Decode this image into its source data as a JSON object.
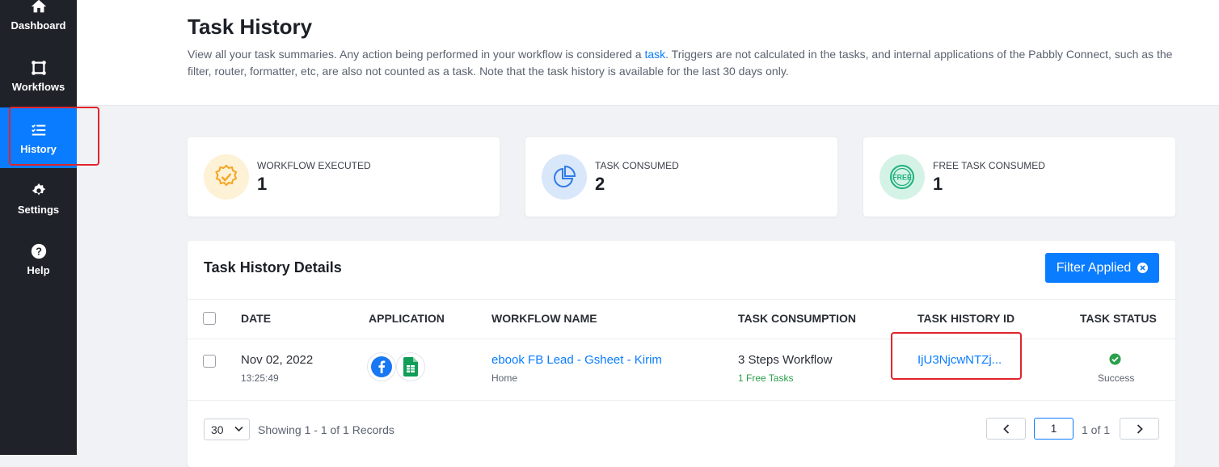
{
  "sidebar": {
    "items": [
      {
        "label": "Dashboard",
        "icon": "home-icon"
      },
      {
        "label": "Workflows",
        "icon": "workflow-icon"
      },
      {
        "label": "History",
        "icon": "history-list-icon",
        "active": true
      },
      {
        "label": "Settings",
        "icon": "gear-icon"
      },
      {
        "label": "Help",
        "icon": "help-icon"
      }
    ]
  },
  "header": {
    "title": "Task History",
    "desc_before": "View all your task summaries. Any action being performed in your workflow is considered a ",
    "desc_link": "task",
    "desc_after": ". Triggers are not calculated in the tasks, and internal applications of the Pabbly Connect, such as the filter, router, formatter, etc, are also not counted as a task. Note that the task history is available for the last 30 days only."
  },
  "stats": [
    {
      "label": "WORKFLOW EXECUTED",
      "value": "1",
      "icon": "badge-check-icon",
      "color": "#f5a623"
    },
    {
      "label": "TASK CONSUMED",
      "value": "2",
      "icon": "pie-chart-icon",
      "color": "#2f7be5"
    },
    {
      "label": "FREE TASK CONSUMED",
      "value": "1",
      "icon": "free-badge-icon",
      "color": "#1fb07a"
    }
  ],
  "details": {
    "title": "Task History Details",
    "filter_label": "Filter Applied",
    "columns": [
      "DATE",
      "APPLICATION",
      "WORKFLOW NAME",
      "TASK CONSUMPTION",
      "TASK HISTORY ID",
      "TASK STATUS"
    ],
    "rows": [
      {
        "date": "Nov 02, 2022",
        "time": "13:25:49",
        "apps": [
          "facebook-icon",
          "google-sheets-icon"
        ],
        "workflow_name": "ebook FB Lead - Gsheet - Kirim",
        "workflow_folder": "Home",
        "consumption": "3 Steps Workflow",
        "free_tasks": "1 Free Tasks",
        "history_id": "IjU3NjcwNTZj...",
        "status": "Success"
      }
    ]
  },
  "footer": {
    "page_size": "30",
    "showing": "Showing 1 - 1 of 1 Records",
    "current_page": "1",
    "page_of": "1 of 1"
  },
  "colors": {
    "accent": "#0a7cff",
    "sidebar_bg": "#1f2329",
    "highlight": "#e0242c",
    "success": "#2aa04a"
  }
}
